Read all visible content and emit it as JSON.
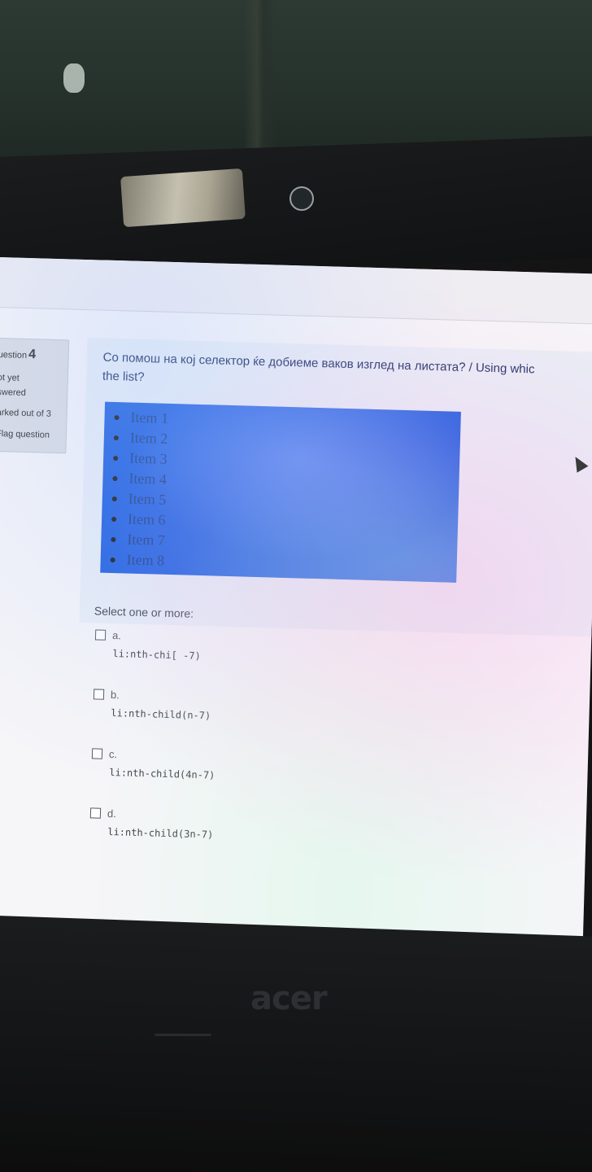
{
  "question": {
    "label": "uestion",
    "number": "4",
    "state_line1": "ot yet",
    "state_line2": "swered",
    "marks": "arked out of 3",
    "flag": "Flag question"
  },
  "question_text": {
    "line1": "Со помош на кој селектор ќе добиеме ваков изглед на листата? / Using whic",
    "line2": "the list?"
  },
  "list_items": [
    "Item 1",
    "Item 2",
    "Item 3",
    "Item 4",
    "Item 5",
    "Item 6",
    "Item 7",
    "Item 8"
  ],
  "select_label": "Select one or more:",
  "options": [
    {
      "letter": "a.",
      "code": "li:nth-chi[  -7)"
    },
    {
      "letter": "b.",
      "code": "li:nth-child(n-7)"
    },
    {
      "letter": "c.",
      "code": "li:nth-child(4n-7)"
    },
    {
      "letter": "d.",
      "code": "li:nth-child(3n-7)"
    }
  ],
  "brand": "acer",
  "colors": {
    "demo_background": "#1e5fe0",
    "question_text": "#1f2f66",
    "info_panel": "#dcdde2"
  },
  "icons": [
    "mouse-cursor-icon",
    "webcam-icon"
  ]
}
